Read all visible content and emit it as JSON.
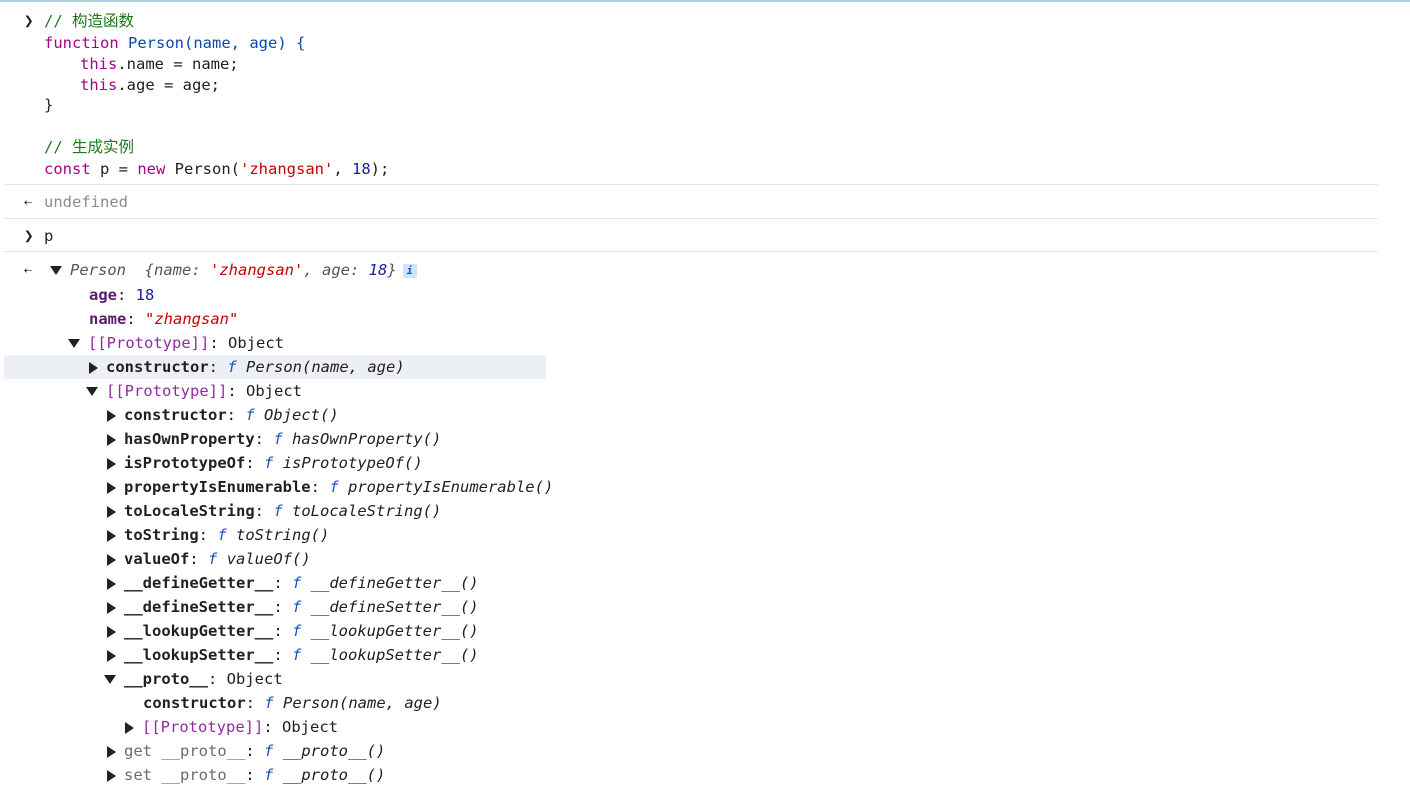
{
  "input1": {
    "comment1": "// 构造函数",
    "fn_kw": "function",
    "fn_name": "Person",
    "fn_params": "(name, age) {",
    "this1_kw": "this",
    "this1_rest": ".name = name;",
    "this2_kw": "this",
    "this2_rest": ".age = age;",
    "close": "}",
    "comment2": "// 生成实例",
    "const_kw": "const",
    "const_var": " p = ",
    "new_kw": "new",
    "new_rest": " Person(",
    "arg_str": "'zhangsan'",
    "arg_sep": ", ",
    "arg_num": "18",
    "end": ");"
  },
  "output1": {
    "value": "undefined"
  },
  "input2": {
    "value": "p"
  },
  "output2": {
    "class_name": "Person",
    "preview_open": "{",
    "preview_name_key": "name: ",
    "preview_name_val": "'zhangsan'",
    "preview_age_key": ", age: ",
    "preview_age_val": "18",
    "preview_close": "}",
    "info": "i",
    "props": {
      "age_key": "age",
      "age_val": "18",
      "name_key": "name",
      "name_val": "\"zhangsan\""
    },
    "proto1": {
      "label": "[[Prototype]]",
      "type": ": Object",
      "constructor_key": "constructor",
      "constructor_f": "f",
      "constructor_val": "Person(name, age)"
    },
    "proto2": {
      "label": "[[Prototype]]",
      "type": ": Object",
      "items": [
        {
          "key": "constructor",
          "val": "Object()"
        },
        {
          "key": "hasOwnProperty",
          "val": "hasOwnProperty()"
        },
        {
          "key": "isPrototypeOf",
          "val": "isPrototypeOf()"
        },
        {
          "key": "propertyIsEnumerable",
          "val": "propertyIsEnumerable()"
        },
        {
          "key": "toLocaleString",
          "val": "toLocaleString()"
        },
        {
          "key": "toString",
          "val": "toString()"
        },
        {
          "key": "valueOf",
          "val": "valueOf()"
        },
        {
          "key": "__defineGetter__",
          "val": "__defineGetter__()"
        },
        {
          "key": "__defineSetter__",
          "val": "__defineSetter__()"
        },
        {
          "key": "__lookupGetter__",
          "val": "__lookupGetter__()"
        },
        {
          "key": "__lookupSetter__",
          "val": "__lookupSetter__()"
        }
      ],
      "proto_key": "__proto__",
      "proto_type": ": Object",
      "proto_constructor_key": "constructor",
      "proto_constructor_val": "Person(name, age)",
      "proto_inner_label": "[[Prototype]]",
      "proto_inner_type": ": Object",
      "get_key": "get __proto__",
      "get_val": "__proto__()",
      "set_key": "set __proto__",
      "set_val": "__proto__()"
    }
  },
  "colors": {
    "keyword": "#a5008e",
    "comment": "#1a7a1a",
    "string": "#c80000",
    "number": "#1a1aa6",
    "property": "#5a1d6b"
  }
}
